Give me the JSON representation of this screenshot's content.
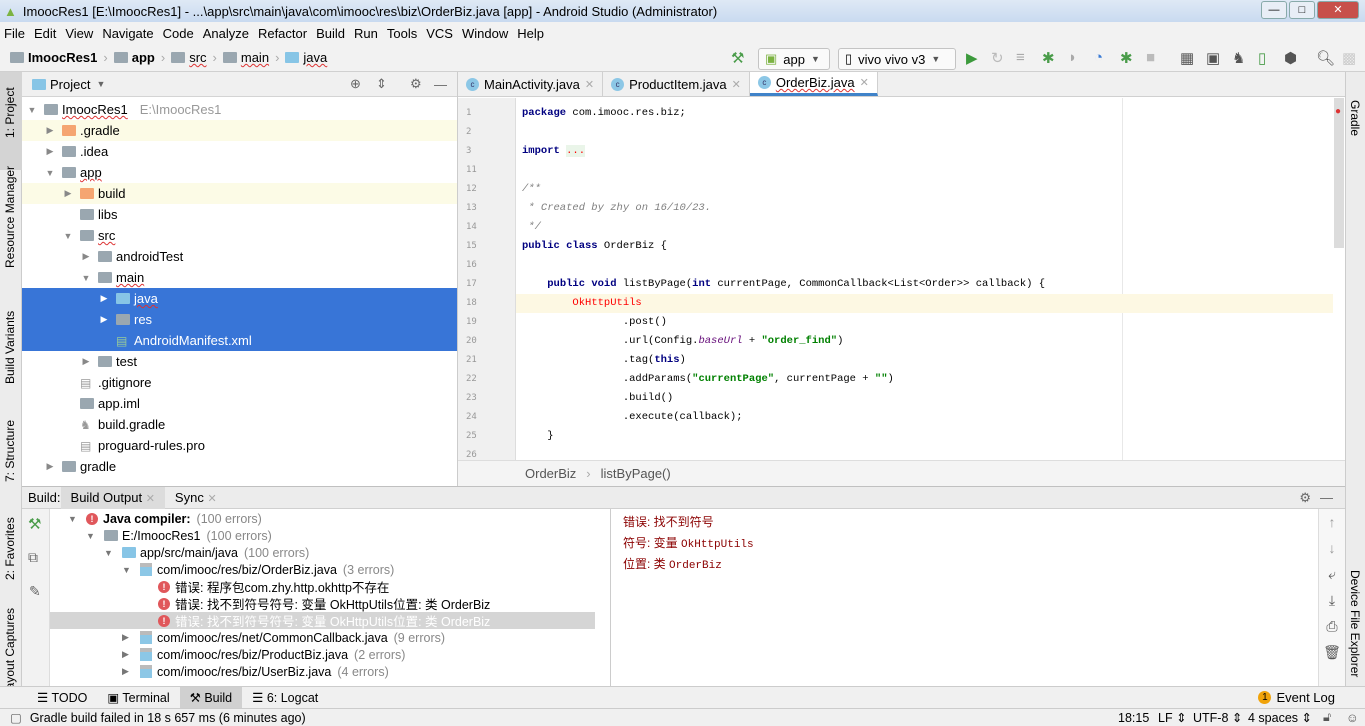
{
  "window": {
    "title": "ImoocRes1 [E:\\ImoocRes1] - ...\\app\\src\\main\\java\\com\\imooc\\res\\biz\\OrderBiz.java [app] - Android Studio (Administrator)"
  },
  "menu": [
    "File",
    "Edit",
    "View",
    "Navigate",
    "Code",
    "Analyze",
    "Refactor",
    "Build",
    "Run",
    "Tools",
    "VCS",
    "Window",
    "Help"
  ],
  "breadcrumb": [
    "ImoocRes1",
    "app",
    "src",
    "main",
    "java"
  ],
  "toolbar": {
    "config": "app",
    "device": "vivo vivo v3"
  },
  "left_strip": [
    "1: Project",
    "Resource Manager",
    "Build Variants",
    "7: Structure",
    "2: Favorites",
    "Layout Captures"
  ],
  "right_strip": [
    "Gradle",
    "Device File Explorer"
  ],
  "project": {
    "title": "Project",
    "tree": [
      {
        "label": "ImoocRes1",
        "hint": "E:\\ImoocRes1",
        "depth": 0,
        "arrow": "down",
        "icon": "module"
      },
      {
        "label": ".gradle",
        "depth": 1,
        "arrow": "right",
        "icon": "folder-orange",
        "style": "yel"
      },
      {
        "label": ".idea",
        "depth": 1,
        "arrow": "right",
        "icon": "folder"
      },
      {
        "label": "app",
        "depth": 1,
        "arrow": "down",
        "icon": "module"
      },
      {
        "label": "build",
        "depth": 2,
        "arrow": "right",
        "icon": "folder-orange",
        "style": "yel"
      },
      {
        "label": "libs",
        "depth": 2,
        "arrow": "",
        "icon": "folder"
      },
      {
        "label": "src",
        "depth": 2,
        "arrow": "down",
        "icon": "folder"
      },
      {
        "label": "androidTest",
        "depth": 3,
        "arrow": "right",
        "icon": "folder"
      },
      {
        "label": "main",
        "depth": 3,
        "arrow": "down",
        "icon": "folder"
      },
      {
        "label": "java",
        "depth": 4,
        "arrow": "right",
        "icon": "folder-blue",
        "style": "sel"
      },
      {
        "label": "res",
        "depth": 4,
        "arrow": "right",
        "icon": "folder",
        "style": "sel"
      },
      {
        "label": "AndroidManifest.xml",
        "depth": 4,
        "arrow": "",
        "icon": "manifest",
        "style": "sel"
      },
      {
        "label": "test",
        "depth": 3,
        "arrow": "right",
        "icon": "folder"
      },
      {
        "label": ".gitignore",
        "depth": 2,
        "arrow": "",
        "icon": "file"
      },
      {
        "label": "app.iml",
        "depth": 2,
        "arrow": "",
        "icon": "module"
      },
      {
        "label": "build.gradle",
        "depth": 2,
        "arrow": "",
        "icon": "gradle"
      },
      {
        "label": "proguard-rules.pro",
        "depth": 2,
        "arrow": "",
        "icon": "file"
      },
      {
        "label": "gradle",
        "depth": 1,
        "arrow": "right",
        "icon": "folder"
      }
    ]
  },
  "editor": {
    "tabs": [
      {
        "label": "MainActivity.java"
      },
      {
        "label": "ProductItem.java"
      },
      {
        "label": "OrderBiz.java",
        "active": true
      }
    ],
    "lines": [
      {
        "n": "1",
        "html": "<span class='kw'>package</span> com.imooc.res.biz;"
      },
      {
        "n": "2",
        "html": ""
      },
      {
        "n": "3",
        "html": "<span class='kw'>import</span> <span class='err' style='background:#eaf5e9'>...</span>"
      },
      {
        "n": "11",
        "html": ""
      },
      {
        "n": "12",
        "html": "<span class='cm'>/**</span>"
      },
      {
        "n": "13",
        "html": "<span class='cm'> * Created by zhy on 16/10/23.</span>"
      },
      {
        "n": "14",
        "html": "<span class='cm'> */</span>"
      },
      {
        "n": "15",
        "html": "<span class='kw'>public class</span> OrderBiz {"
      },
      {
        "n": "16",
        "html": ""
      },
      {
        "n": "17",
        "html": "    <span class='kw'>public void</span> listByPage(<span class='kw'>int</span> currentPage, CommonCallback&lt;List&lt;Order&gt;&gt; callback) {"
      },
      {
        "n": "18",
        "html": "        <span class='err'>OkHttpUtils</span>",
        "cur": true
      },
      {
        "n": "19",
        "html": "                .post()"
      },
      {
        "n": "20",
        "html": "                .url(Config.<span class='fld'>baseUrl</span> + <span class='str'>\"order_find\"</span>)"
      },
      {
        "n": "21",
        "html": "                .tag(<span class='kw'>this</span>)"
      },
      {
        "n": "22",
        "html": "                .addParams(<span class='str'>\"currentPage\"</span>, currentPage + <span class='str'>\"\"</span>)"
      },
      {
        "n": "23",
        "html": "                .build()"
      },
      {
        "n": "24",
        "html": "                .execute(callback);"
      },
      {
        "n": "25",
        "html": "    }"
      },
      {
        "n": "26",
        "html": ""
      }
    ],
    "crumb": [
      "OrderBiz",
      "listByPage()"
    ]
  },
  "build": {
    "label": "Build:",
    "tabs": [
      "Build Output",
      "Sync"
    ],
    "tree": [
      {
        "label": "Java compiler:",
        "count": "(100 errors)",
        "depth": 0,
        "arrow": "▼",
        "icon": "error",
        "bold": true
      },
      {
        "label": "E:/ImoocRes1",
        "count": "(100 errors)",
        "depth": 1,
        "arrow": "▼",
        "icon": "module"
      },
      {
        "label": "app/src/main/java",
        "count": "(100 errors)",
        "depth": 2,
        "arrow": "▼",
        "icon": "folder"
      },
      {
        "label": "com/imooc/res/biz/OrderBiz.java",
        "count": "(3 errors)",
        "depth": 3,
        "arrow": "▼",
        "icon": "java"
      },
      {
        "label": "错误: 程序包com.zhy.http.okhttp不存在",
        "count": "",
        "depth": 4,
        "arrow": "",
        "icon": "error"
      },
      {
        "label": "错误: 找不到符号符号:   变量 OkHttpUtils位置: 类 OrderBiz",
        "count": "",
        "depth": 4,
        "arrow": "",
        "icon": "error"
      },
      {
        "label": "错误: 找不到符号符号:   变量 OkHttpUtils位置: 类 OrderBiz",
        "count": "",
        "depth": 4,
        "arrow": "",
        "icon": "error",
        "selected": true
      },
      {
        "label": "com/imooc/res/net/CommonCallback.java",
        "count": "(9 errors)",
        "depth": 3,
        "arrow": "▶",
        "icon": "java"
      },
      {
        "label": "com/imooc/res/biz/ProductBiz.java",
        "count": "(2 errors)",
        "depth": 3,
        "arrow": "▶",
        "icon": "java"
      },
      {
        "label": "com/imooc/res/biz/UserBiz.java",
        "count": "(4 errors)",
        "depth": 3,
        "arrow": "▶",
        "icon": "java"
      }
    ],
    "console": [
      {
        "cn": "错误: 找不到符号",
        "m": ""
      },
      {
        "cn": "符号:    变量 ",
        "m": "OkHttpUtils"
      },
      {
        "cn": "位置: 类 ",
        "m": "OrderBiz"
      }
    ]
  },
  "tooltabs": [
    "TODO",
    "Terminal",
    "Build",
    "6: Logcat"
  ],
  "event_log": {
    "count": "1",
    "label": "Event Log"
  },
  "status": {
    "message": "Gradle build failed in 18 s 657 ms (6 minutes ago)",
    "position": "18:15",
    "line_sep": "LF",
    "encoding": "UTF-8",
    "indent": "4 spaces"
  },
  "colors": {
    "selection": "#3875d7",
    "error": "#e0575b",
    "accent": "#4083c9"
  }
}
